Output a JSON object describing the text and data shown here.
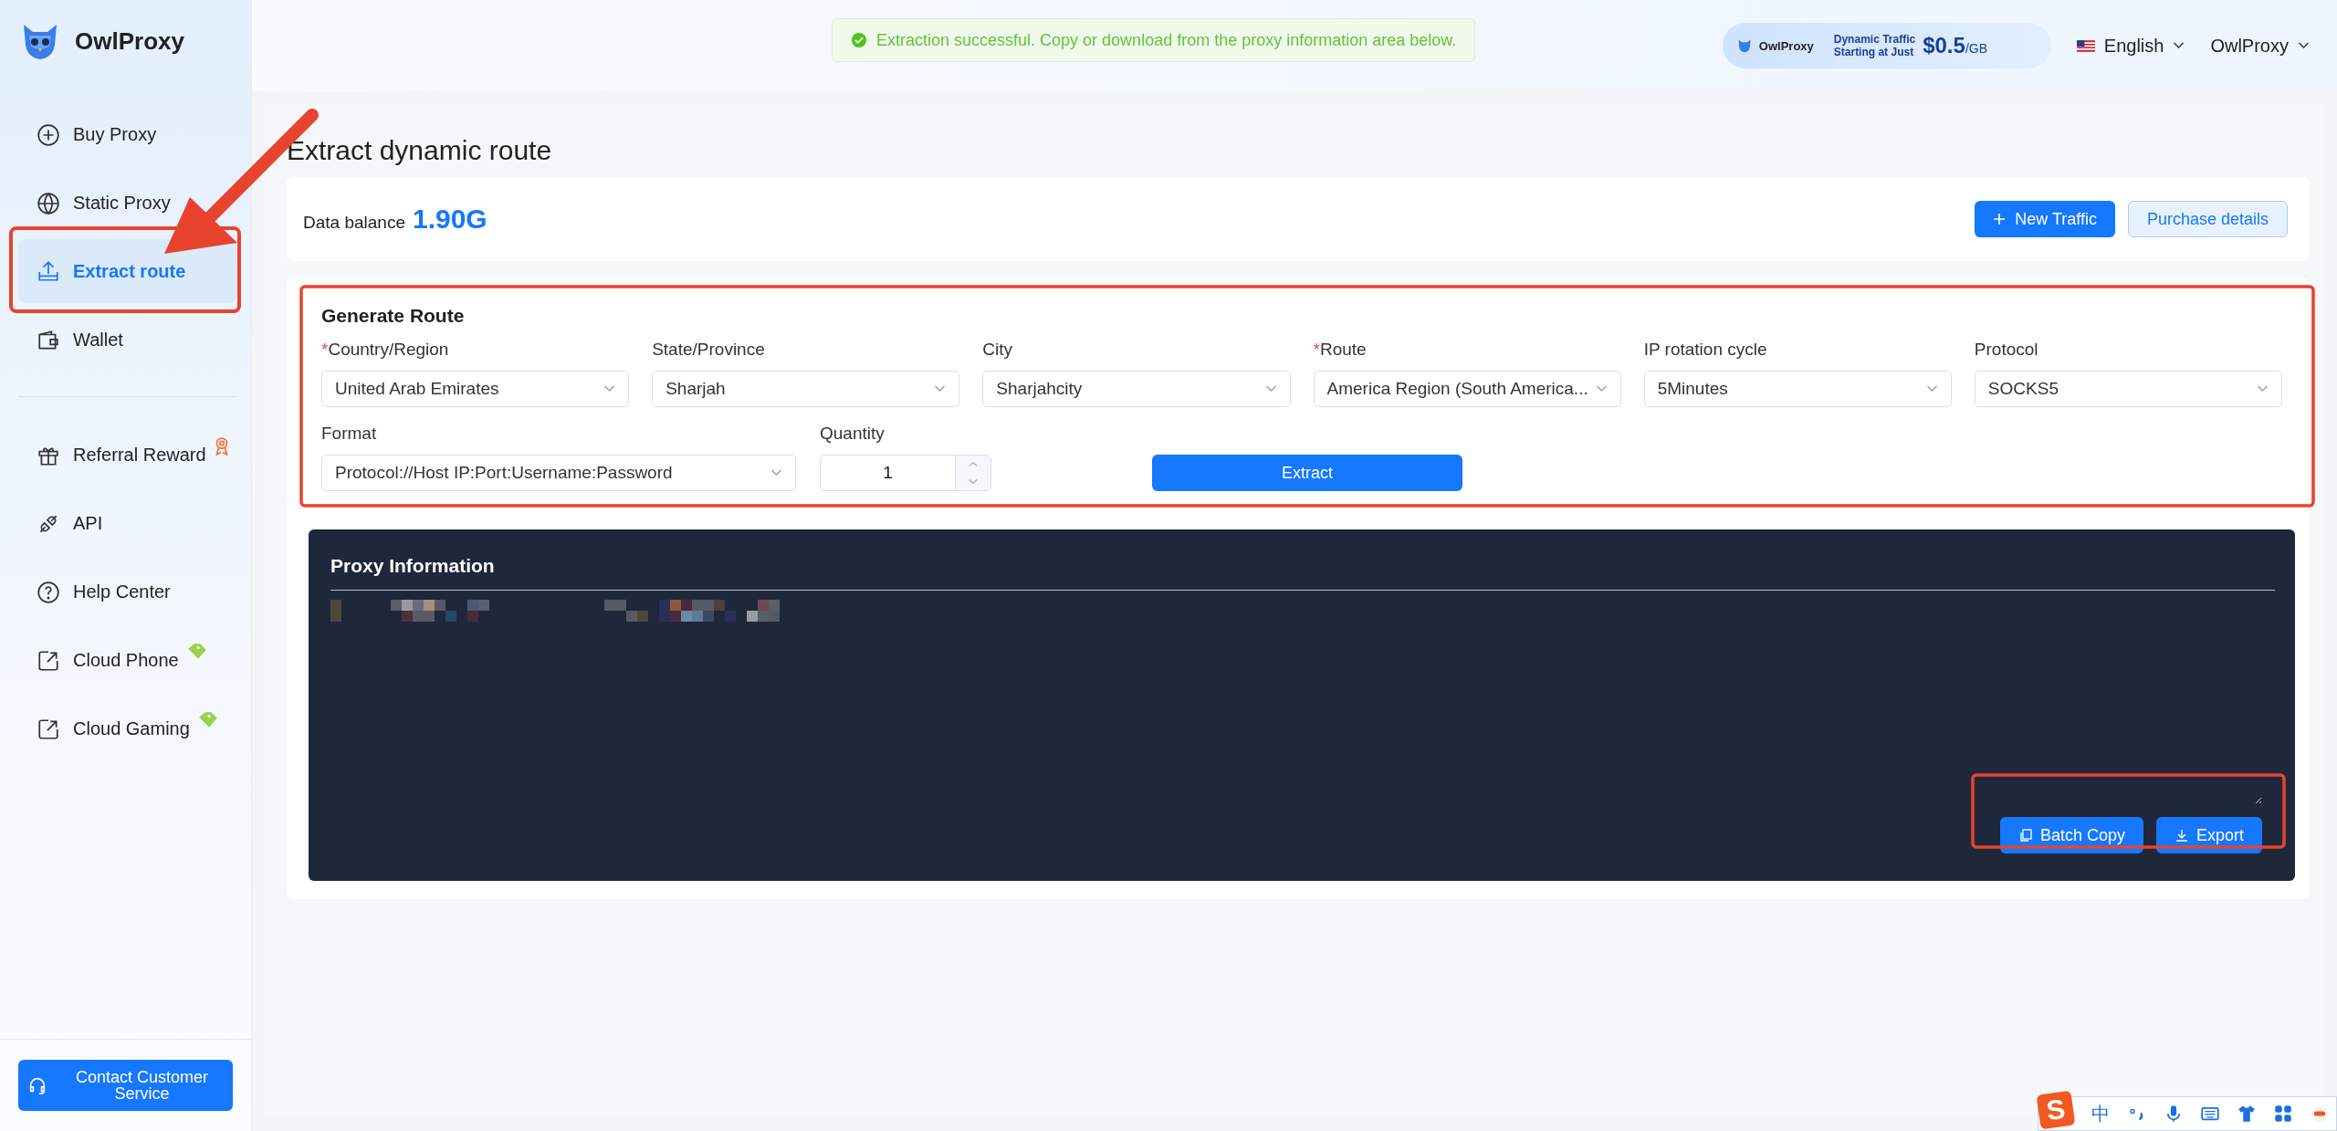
{
  "brand": {
    "name": "OwlProxy"
  },
  "toast": {
    "text": "Extraction successful. Copy or download from the proxy information area below."
  },
  "promo": {
    "brand": "OwlProxy",
    "line1": "Dynamic Traffic",
    "line2": "Starting at Just",
    "price": "$0.5",
    "unit": "/GB"
  },
  "language": {
    "label": "English"
  },
  "user": {
    "name": "OwlProxy"
  },
  "sidebar": {
    "primary_items": [
      {
        "label": "Buy Proxy",
        "selected": false
      },
      {
        "label": "Static Proxy",
        "selected": false
      },
      {
        "label": "Extract route",
        "selected": true
      },
      {
        "label": "Wallet",
        "selected": false
      }
    ],
    "secondary_items": [
      {
        "label": "Referral Reward",
        "selected": false
      },
      {
        "label": "API",
        "selected": false
      },
      {
        "label": "Help Center",
        "selected": false
      },
      {
        "label": "Cloud Phone",
        "selected": false
      },
      {
        "label": "Cloud Gaming",
        "selected": false
      }
    ],
    "contact_button": {
      "label": "Contact Customer Service"
    }
  },
  "page": {
    "title": "Extract dynamic route"
  },
  "balance": {
    "label": "Data balance",
    "value": "1.90G",
    "buttons": [
      {
        "label": "New Traffic",
        "kind": "primary"
      },
      {
        "label": "Purchase details",
        "kind": "secondary"
      }
    ]
  },
  "generate_route": {
    "title": "Generate Route",
    "required_mark": "*",
    "fields": [
      {
        "label": "Country/Region",
        "required": true,
        "value": "United Arab Emirates"
      },
      {
        "label": "State/Province",
        "required": false,
        "value": "Sharjah"
      },
      {
        "label": "City",
        "required": false,
        "value": "Sharjahcity"
      },
      {
        "label": "Route",
        "required": true,
        "value": "America Region (South America..."
      },
      {
        "label": "IP rotation cycle",
        "required": false,
        "value": "5Minutes"
      },
      {
        "label": "Protocol",
        "required": false,
        "value": "SOCKS5"
      }
    ],
    "format": {
      "label": "Format",
      "value": "Protocol://Host IP:Port:Username:Password"
    },
    "quantity": {
      "label": "Quantity",
      "value": "1"
    },
    "extract_button": {
      "label": "Extract"
    }
  },
  "proxy_info": {
    "title": "Proxy Information",
    "actions": [
      {
        "label": "Batch Copy"
      },
      {
        "label": "Export"
      }
    ]
  },
  "ime_toolbar": {
    "logo": "S",
    "mode": "中"
  }
}
